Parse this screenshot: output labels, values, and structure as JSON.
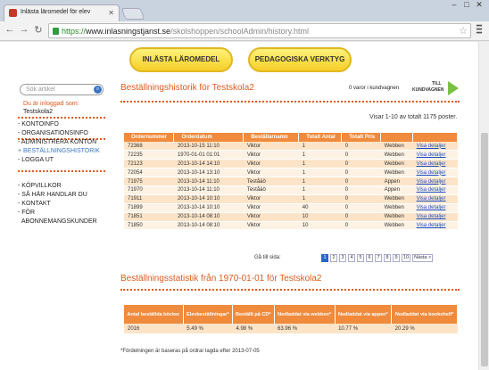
{
  "browser": {
    "tab_title": "Inlästa läromedel för elev",
    "url_scheme": "https://",
    "url_host": "www.inlasningstjanst.se",
    "url_path": "/skolshoppen/schoolAdmin/history.html"
  },
  "topnav": {
    "btn1": "INLÄSTA LÄROMEDEL",
    "btn2": "PEDAGOGISKA VERKTYG"
  },
  "sidebar": {
    "search_placeholder": "Sök artikel",
    "logged_in_label": "Du är inloggad som:",
    "school": "Testskola2",
    "items": [
      "KONTOINFO",
      "ORGANISATIONSINFO",
      "ADMINISTRERA KONTON",
      "BESTÄLLNINGSHISTORIK",
      "LOGGA UT"
    ],
    "items2": [
      "KÖPVILLKOR",
      "SÅ HÄR HANDLAR DU",
      "KONTAKT",
      "FÖR",
      "ABONNEMANGSKUNDER"
    ]
  },
  "main": {
    "title": "Beställningshistorik för Testskola2",
    "cart_text": "0 varor i kundvagnen",
    "cart_logo_top": "TILL",
    "cart_logo_bottom": "KUNDVAGNEN",
    "showing": "Visar 1-10 av totalt 1175 poster.",
    "headers": [
      "Ordernummer",
      "Orderdatum",
      "Beställarnamn",
      "Totalt Antal",
      "Totalt Pris",
      "",
      ""
    ],
    "rows": [
      [
        "72368",
        "2013-10-15 11:10",
        "Viktor",
        "1",
        "0",
        "Webben",
        "Visa detaljer"
      ],
      [
        "72235",
        "1970-01-01 01:01",
        "Viktor",
        "1",
        "0",
        "Webben",
        "Visa detaljer"
      ],
      [
        "72123",
        "2013-10-14 14:10",
        "Viktor",
        "1",
        "0",
        "Webben",
        "Visa detaljer"
      ],
      [
        "72054",
        "2013-10-14 13:10",
        "Viktor",
        "1",
        "0",
        "Webben",
        "Visa detaljer"
      ],
      [
        "71975",
        "2013-10-14 11:10",
        "Teståäö",
        "1",
        "0",
        "Appen",
        "Visa detaljer"
      ],
      [
        "71970",
        "2013-10-14 11:10",
        "Teståäö",
        "1",
        "0",
        "Appen",
        "Visa detaljer"
      ],
      [
        "71911",
        "2013-10-14 10:10",
        "Viktor",
        "1",
        "0",
        "Webben",
        "Visa detaljer"
      ],
      [
        "71899",
        "2013-10-14 10:10",
        "Viktor",
        "40",
        "0",
        "Webben",
        "Visa detaljer"
      ],
      [
        "71851",
        "2013-10-14 08:10",
        "Viktor",
        "10",
        "0",
        "Webben",
        "Visa detaljer"
      ],
      [
        "71850",
        "2013-10-14 08:10",
        "Viktor",
        "10",
        "0",
        "Webben",
        "Visa detaljer"
      ]
    ],
    "goto_label": "Gå till sida:",
    "pages": [
      "1",
      "2",
      "3",
      "4",
      "5",
      "6",
      "7",
      "8",
      "9",
      "10",
      "Nästa >"
    ],
    "stats_title": "Beställningsstatistik från 1970-01-01 för Testskola2",
    "stats_headers": [
      "Antal beställda böcker",
      "Elevbeställningar*",
      "Beställt på CD*",
      "Nedladdat via webben*",
      "Nedladdat via appen*",
      "Nedladdat via bookshelf*"
    ],
    "stats_values": [
      "2016",
      "5.49 %",
      "4.98 %",
      "63.96 %",
      "10.77 %",
      "20.29 %"
    ],
    "footnote": "*Fördelningen är baseras på ordrar lagda efter 2013-07-05"
  }
}
